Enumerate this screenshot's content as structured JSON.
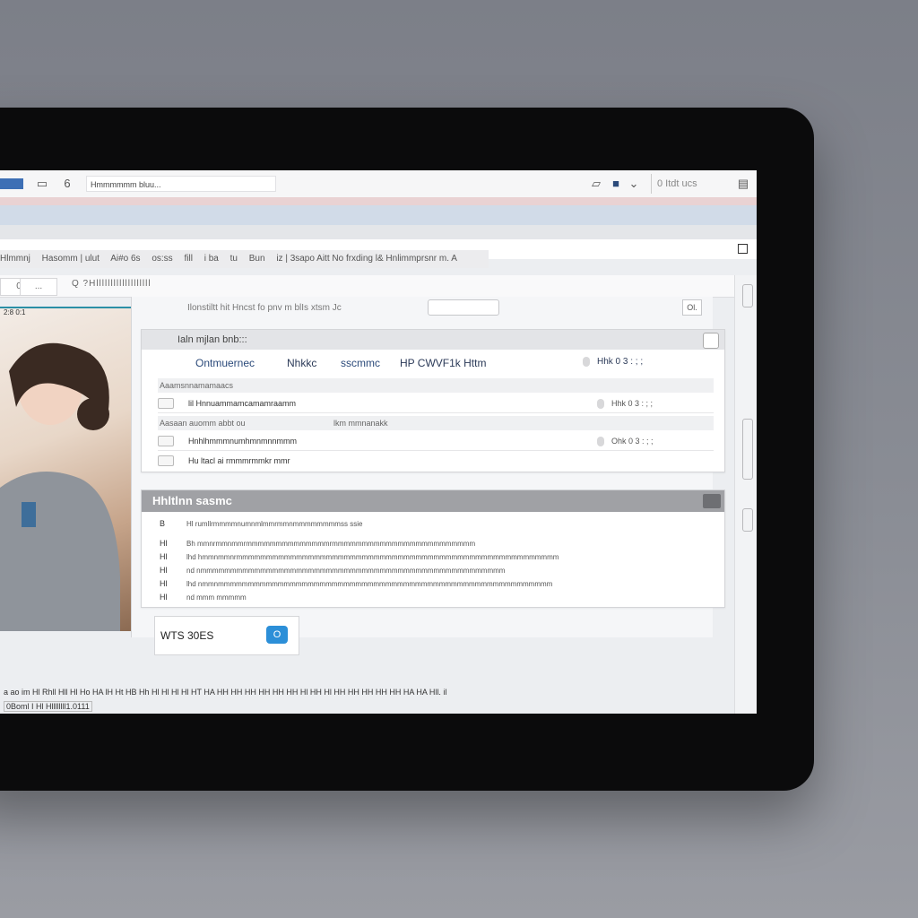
{
  "window": {
    "tab_number": "6",
    "title_field": "Hmmmmmm bluu...",
    "search_label": "0 Itdt ucs"
  },
  "menubar": {
    "items": [
      "Hlmmnj",
      "Hasomm | ulut",
      "Ai#o 6s",
      "os:ss",
      "fill",
      "i ba",
      "tu",
      "Bun",
      "iz | 3sapo Aitt No frxding l& Hnlimmprsnr m. A"
    ]
  },
  "ribbon": {
    "btn1": "0",
    "btn2": "...",
    "text": "Q ?Hlllllllllllllllllll"
  },
  "photo_label": "2:8 0:1",
  "panel": {
    "header": "Ilonstiltt  hit  Hncst  fo  pnv m blIs xtsm Jc",
    "close_label": "Ol."
  },
  "card1": {
    "title": "Ialn mjlan bnb:::",
    "columns": [
      "Ontmuernec",
      "Nhkkc",
      "sscmmc",
      "HP CWVF1k Httm"
    ],
    "right_head": "Hhk 0 3 : ; ;",
    "subhead1": "Aaamsnnamamaacs",
    "row1_text": "lil Hnnuammamcamamraamm",
    "row1_val": "Hhk 0 3 : ; ;",
    "subhead2": "Aasaan auomm abbt ou",
    "subhead2b": "lkm mmnanakk",
    "row2_text": "Hnhlhmmmnumhmnmnnmmm",
    "row2_val": "Ohk 0 3 : ; ;",
    "row3_text": "Hu ltacl ai rmmmrmmkr mmr"
  },
  "card2": {
    "title": "Hhltlnn sasmc",
    "lines": [
      {
        "bullet": "B",
        "text": "Hl rumllrmmmmnumnmlmmrmmnmmmmmmmmss ssie"
      },
      {
        "bullet": "Hl",
        "text": "Bh mmnrmmnmmrmmmmmmmmmmmmmmrmmmmmmmmmmmmmmmmmmmmmmmm"
      },
      {
        "bullet": "Hl",
        "text": "lhd hmmnmmnrmmmmmmmmmmmmmmmmmmmmmmmmmmmmmmmmmmmmmmmmmmmmmmmmmmmmmm"
      },
      {
        "bullet": "Hl",
        "text": "nd nmmmmmmmmmmmmmmmmmmmmmmmmmmmmmmmmmmmmmmmmmmmmmmmmmmm"
      },
      {
        "bullet": "Hl",
        "text": "lhd nmmnmmmmmmmmmmmmmmmmmmmmmmmmmmmmmmmmmmmmmmmmmmmmmmmmmmmmmmmm"
      },
      {
        "bullet": "Hl",
        "text": "nd  mmm mmmmm"
      }
    ]
  },
  "footer": {
    "label": "WTS 30ES",
    "button": "O"
  },
  "status": {
    "line1": "a ao im Hl Rhll Hll Hl Ho HA lH Ht HB Hh Hl Hl Hl Hl HT HA HH HH HH HH HH HH Hl HH Hl HH HH HH HH HH HA HA Hll. il",
    "line2": "0Boml I Hl Hllllllll1.0111"
  },
  "colors": {
    "accent": "#2c8fd8",
    "stripe_pink": "#e9d2d3",
    "stripe_blue": "#d1dbe8"
  }
}
